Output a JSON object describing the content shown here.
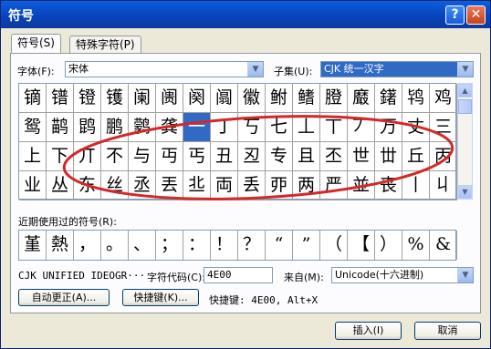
{
  "window": {
    "title": "符号"
  },
  "tabs": [
    {
      "label": "符号(S)"
    },
    {
      "label": "特殊字符(P)"
    }
  ],
  "font": {
    "label": "字体(F):",
    "value": "宋体"
  },
  "subset": {
    "label": "子集(U):",
    "value": "CJK 统一汉字"
  },
  "grid": {
    "rows": [
      [
        "镝",
        "镨",
        "镫",
        "镬",
        "阑",
        "阓",
        "阕",
        "阘",
        "徽",
        "鲋",
        "鳍",
        "膯",
        "黀",
        "鐯",
        "鸨",
        "鸡"
      ],
      [
        "鸳",
        "鹋",
        "鹍",
        "鹏",
        "鹲",
        "龚",
        "一",
        "丁",
        "丂",
        "七",
        "丄",
        "丅",
        "丆",
        "万",
        "丈",
        "三"
      ],
      [
        "上",
        "下",
        "丌",
        "不",
        "与",
        "丏",
        "丐",
        "丑",
        "丒",
        "专",
        "且",
        "丕",
        "世",
        "丗",
        "丘",
        "丙"
      ],
      [
        "业",
        "丛",
        "东",
        "丝",
        "丞",
        "丟",
        "丠",
        "両",
        "丢",
        "丣",
        "两",
        "严",
        "並",
        "丧",
        "丨",
        "丩"
      ]
    ],
    "selected": {
      "row": 1,
      "col": 6
    }
  },
  "recent": {
    "label": "近期使用过的符号(R):",
    "items": [
      "堇",
      "熱",
      "，",
      "。",
      "、",
      "；",
      "：",
      "！",
      "？",
      "“",
      "”",
      "（",
      "【",
      "）",
      "%",
      "&"
    ]
  },
  "char_name": "CJK UNIFIED IDEOGR···",
  "char_code": {
    "label": "字符代码(C):",
    "value": "4E00"
  },
  "from": {
    "label": "来自(M):",
    "value": "Unicode(十六进制)"
  },
  "buttons": {
    "autocorrect": "自动更正(A)...",
    "shortcut_key": "快捷键(K)...",
    "insert": "插入(I)",
    "cancel": "取消"
  },
  "shortcut_text": "快捷键: 4E00, Alt+X",
  "colors": {
    "title_blue": "#0a5fe0",
    "selection": "#316ac5",
    "annotation_red": "#d42828"
  }
}
